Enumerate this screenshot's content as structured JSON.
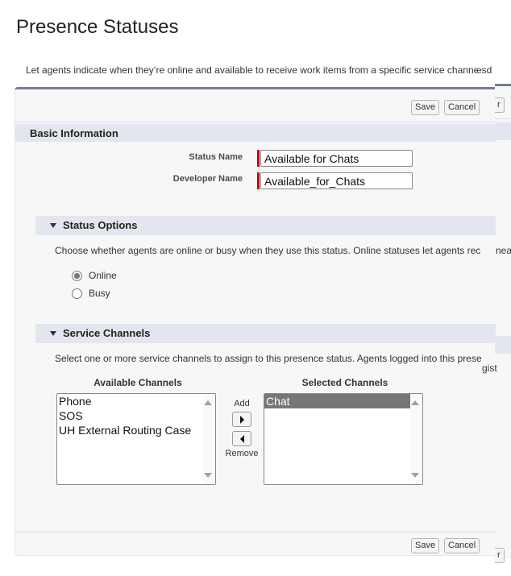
{
  "page": {
    "title": "Presence Statuses",
    "description": "Let agents indicate when they’re online and available to receive work items from a specific service channel.",
    "description_overflow": "esd"
  },
  "toolbar": {
    "save_label": "Save",
    "cancel_label": "Cancel",
    "ghost_label": "r"
  },
  "basic_info": {
    "title": "Basic Information",
    "fields": [
      {
        "label": "Status Name",
        "value": "Available for Chats",
        "required": true
      },
      {
        "label": "Developer Name",
        "value": "Available_for_Chats",
        "required": true
      }
    ]
  },
  "status_options": {
    "title": "Status Options",
    "help": "Choose whether agents are online or busy when they use this status. Online statuses let agents rec",
    "help_overflow": "nea",
    "options": [
      {
        "label": "Online",
        "checked": true
      },
      {
        "label": "Busy",
        "checked": false
      }
    ]
  },
  "service_channels": {
    "title": "Service Channels",
    "help": "Select one or more service channels to assign to this presence status. Agents logged into this prese",
    "help_overflow": "gist",
    "available_header": "Available Channels",
    "selected_header": "Selected Channels",
    "available": [
      "Phone",
      "SOS",
      "UH External Routing Case"
    ],
    "selected": [
      "Chat"
    ],
    "add_label": "Add",
    "remove_label": "Remove"
  }
}
